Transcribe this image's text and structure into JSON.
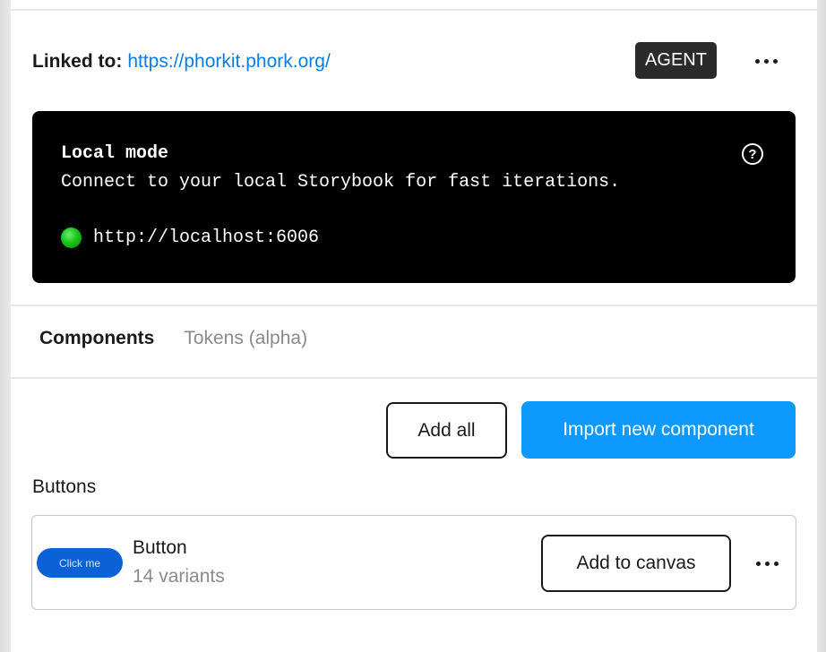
{
  "header": {
    "linked_label": "Linked to:",
    "linked_url": "https://phorkit.phork.org/",
    "badge": "AGENT",
    "more_icon": "more-horizontal-icon"
  },
  "local_mode": {
    "title": "Local mode",
    "description": "Connect to your local Storybook for fast iterations.",
    "help_icon": "?",
    "status_color": "#19c419",
    "url": "http://localhost:6006"
  },
  "tabs": [
    {
      "label": "Components",
      "active": true
    },
    {
      "label": "Tokens (alpha)",
      "active": false
    }
  ],
  "actions": {
    "add_all": "Add all",
    "import_new": "Import new component"
  },
  "groups": [
    {
      "label": "Buttons",
      "components": [
        {
          "preview_label": "Click me",
          "name": "Button",
          "variants": "14 variants",
          "add_label": "Add to canvas"
        }
      ]
    }
  ],
  "colors": {
    "link": "#0a7ee6",
    "primary": "#0d99ff",
    "badge_bg": "#2b2b2b",
    "preview_button": "#0a62d6"
  }
}
